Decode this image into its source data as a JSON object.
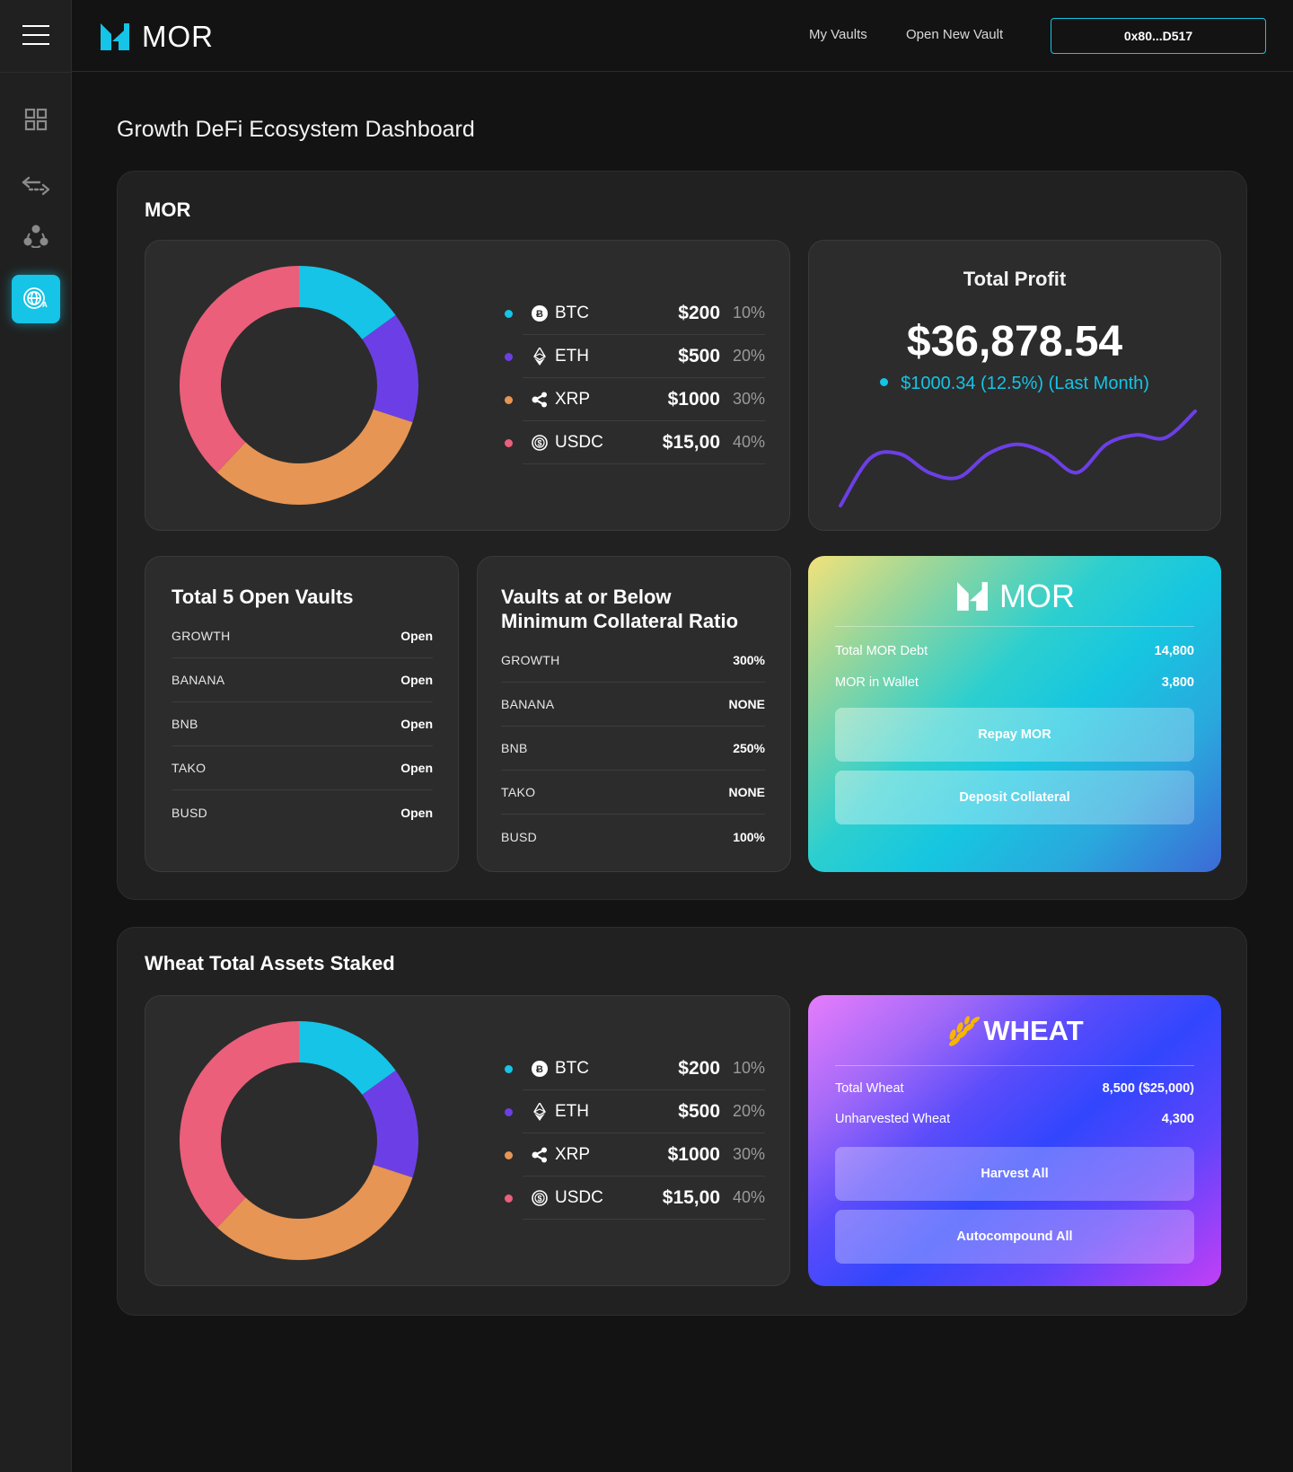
{
  "app": {
    "brand": "MOR"
  },
  "header": {
    "nav": [
      {
        "label": "My Vaults"
      },
      {
        "label": "Open New Vault"
      }
    ],
    "wallet_label": "0x80...D517"
  },
  "sidebar": {
    "items": [
      {
        "icon": "dashboard-grid-icon",
        "active": false
      },
      {
        "icon": "swap-arrows-icon",
        "active": false
      },
      {
        "icon": "network-nodes-icon",
        "active": false
      },
      {
        "icon": "globe-language-icon",
        "active": true
      }
    ]
  },
  "page": {
    "title": "Growth DeFi Ecosystem Dashboard"
  },
  "colors": {
    "accent": "#15c4e6",
    "btc": "#15c4e6",
    "eth": "#6c3fe6",
    "xrp": "#e69554",
    "usdc": "#eb5f7a",
    "line": "#6c3fe6"
  },
  "mor_section": {
    "title": "MOR",
    "assets": [
      {
        "symbol": "BTC",
        "icon": "bitcoin-icon",
        "value": "$200",
        "pct": "10%"
      },
      {
        "symbol": "ETH",
        "icon": "ethereum-icon",
        "value": "$500",
        "pct": "20%"
      },
      {
        "symbol": "XRP",
        "icon": "ripple-icon",
        "value": "$1000",
        "pct": "30%"
      },
      {
        "symbol": "USDC",
        "icon": "usdc-icon",
        "value": "$15,00",
        "pct": "40%"
      }
    ],
    "profit": {
      "title": "Total Profit",
      "value": "$36,878.54",
      "change": "$1000.34 (12.5%) (Last Month)"
    },
    "open_vaults": {
      "title": "Total 5 Open Vaults",
      "rows": [
        {
          "name": "GROWTH",
          "status": "Open"
        },
        {
          "name": "BANANA",
          "status": "Open"
        },
        {
          "name": "BNB",
          "status": "Open"
        },
        {
          "name": "TAKO",
          "status": "Open"
        },
        {
          "name": "BUSD",
          "status": "Open"
        }
      ]
    },
    "min_collateral": {
      "title_line1": "Vaults at or Below",
      "title_line2": "Minimum Collateral Ratio",
      "rows": [
        {
          "name": "GROWTH",
          "value": "300%"
        },
        {
          "name": "BANANA",
          "value": "NONE"
        },
        {
          "name": "BNB",
          "value": "250%"
        },
        {
          "name": "TAKO",
          "value": "NONE"
        },
        {
          "name": "BUSD",
          "value": "100%"
        }
      ]
    },
    "promo": {
      "brand": "MOR",
      "rows": [
        {
          "label": "Total MOR Debt",
          "value": "14,800"
        },
        {
          "label": "MOR in Wallet",
          "value": "3,800"
        }
      ],
      "buttons": [
        {
          "label": "Repay MOR"
        },
        {
          "label": "Deposit Collateral"
        }
      ]
    }
  },
  "wheat_section": {
    "title": "Wheat Total Assets Staked",
    "assets": [
      {
        "symbol": "BTC",
        "icon": "bitcoin-icon",
        "value": "$200",
        "pct": "10%"
      },
      {
        "symbol": "ETH",
        "icon": "ethereum-icon",
        "value": "$500",
        "pct": "20%"
      },
      {
        "symbol": "XRP",
        "icon": "ripple-icon",
        "value": "$1000",
        "pct": "30%"
      },
      {
        "symbol": "USDC",
        "icon": "usdc-icon",
        "value": "$15,00",
        "pct": "40%"
      }
    ],
    "promo": {
      "brand": "WHEAT",
      "rows": [
        {
          "label": "Total Wheat",
          "value": "8,500 ($25,000)"
        },
        {
          "label": "Unharvested Wheat",
          "value": "4,300"
        }
      ],
      "buttons": [
        {
          "label": "Harvest All"
        },
        {
          "label": "Autocompound All"
        }
      ]
    }
  },
  "chart_data": [
    {
      "type": "pie",
      "title": "MOR",
      "categories": [
        "BTC",
        "ETH",
        "XRP",
        "USDC"
      ],
      "values": [
        15,
        15,
        32,
        38
      ],
      "colors": [
        "#15c4e6",
        "#6c3fe6",
        "#e69554",
        "#eb5f7a"
      ],
      "donut": true
    },
    {
      "type": "line",
      "title": "Total Profit",
      "x": [
        0,
        1,
        2,
        3,
        4,
        5,
        6,
        7,
        8,
        9,
        10,
        11,
        12
      ],
      "values": [
        0.0,
        0.5,
        0.55,
        0.35,
        0.3,
        0.55,
        0.65,
        0.55,
        0.35,
        0.65,
        0.75,
        0.72,
        1.0
      ],
      "color": "#6c3fe6"
    },
    {
      "type": "pie",
      "title": "Wheat Total Assets Staked",
      "categories": [
        "BTC",
        "ETH",
        "XRP",
        "USDC"
      ],
      "values": [
        15,
        15,
        32,
        38
      ],
      "colors": [
        "#15c4e6",
        "#6c3fe6",
        "#e69554",
        "#eb5f7a"
      ],
      "donut": true
    }
  ]
}
